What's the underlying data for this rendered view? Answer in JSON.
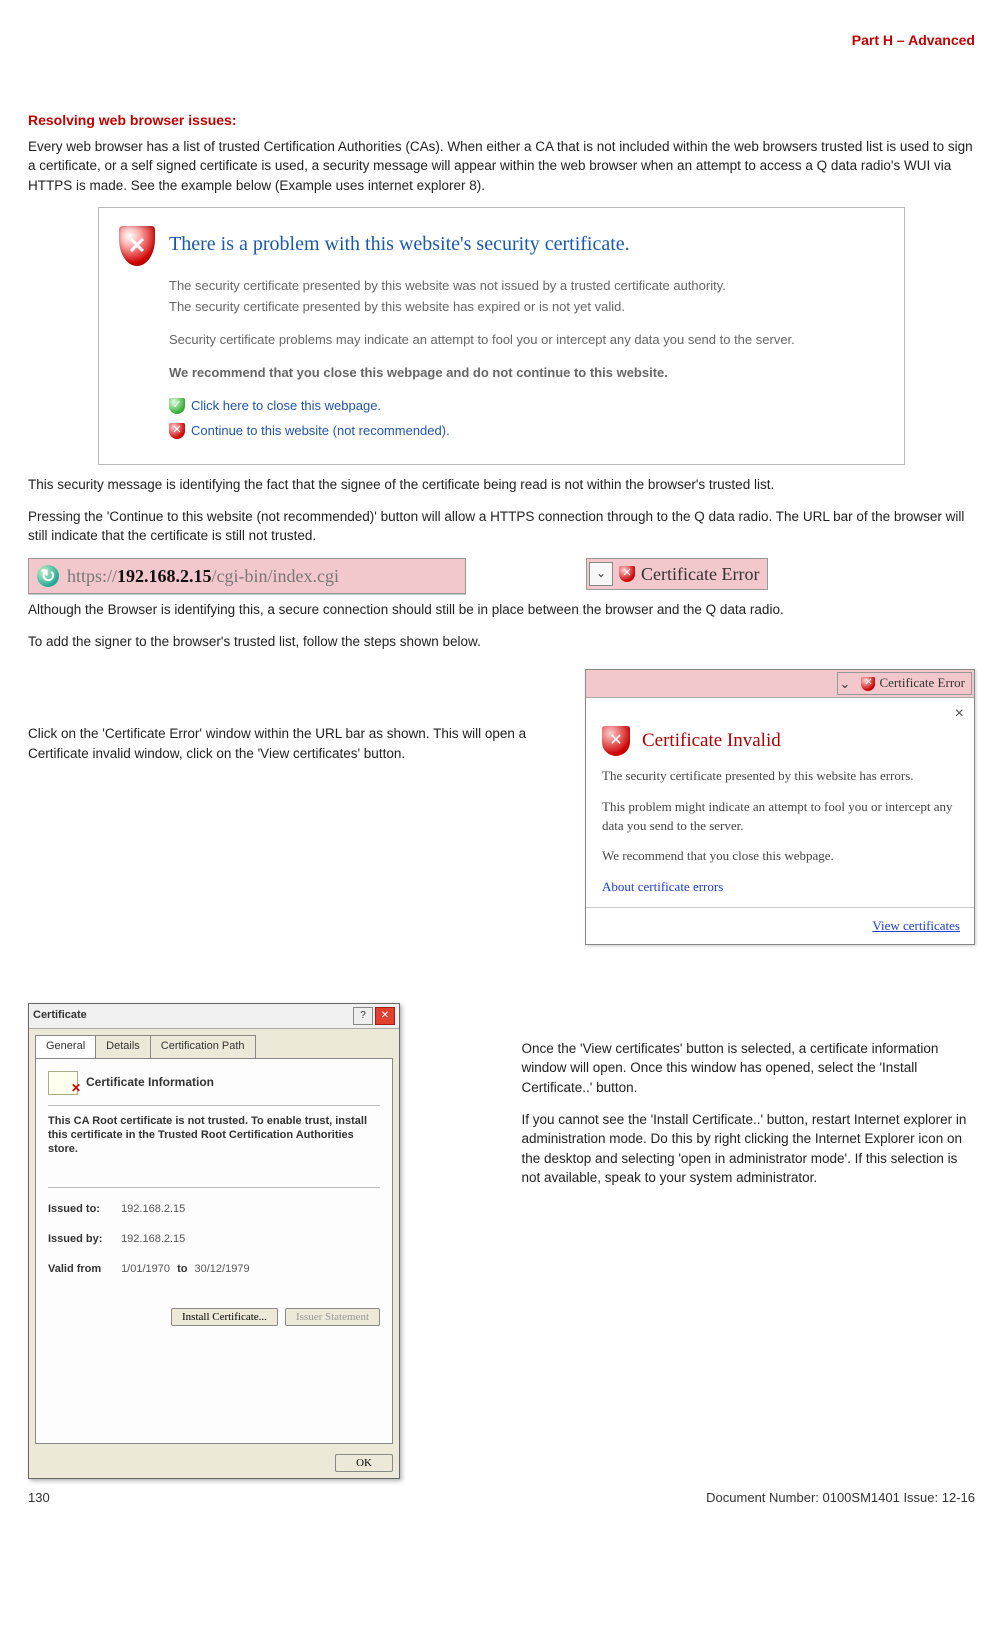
{
  "header": {
    "part": "Part H – Advanced"
  },
  "intro": {
    "heading": "Resolving web browser issues:",
    "p1": "Every web browser has a list of trusted Certification Authorities (CAs). When either a CA that is not included within the web browsers trusted list is used to sign a certificate, or a self signed certificate is used, a security message will appear within the web browser when an attempt to access a Q data radio's WUI via HTTPS is made. See the example below (Example uses internet explorer 8)."
  },
  "ie_warning": {
    "title": "There is a problem with this website's security certificate.",
    "l1": "The security certificate presented by this website was not issued by a trusted certificate authority.",
    "l2": "The security certificate presented by this website has expired or is not yet valid.",
    "l3": "Security certificate problems may indicate an attempt to fool you or intercept any data you send to the server.",
    "l4": "We recommend that you close this webpage and do not continue to this website.",
    "link_close": "Click here to close this webpage.",
    "link_continue": "Continue to this website (not recommended)."
  },
  "mid": {
    "p2": "This security message is identifying the fact that the signee of the certificate being read is not within the browser's trusted list.",
    "p3": "Pressing the 'Continue to this website (not recommended)' button will allow a HTTPS connection through to the Q data radio. The URL bar of the browser will still indicate that the certificate is still not trusted.",
    "url_scheme": "https://",
    "url_ip": "192.168.2.15",
    "url_path": "/cgi-bin/index.cgi",
    "cert_error_label": "Certificate Error",
    "p4": "Although the Browser is identifying this, a secure connection should still be in place between the browser and the Q data radio.",
    "p5": "To add the signer to the browser's trusted list, follow the steps shown below."
  },
  "step1": {
    "left_text": "Click on the 'Certificate Error' window within the URL bar as shown. This will open a Certificate invalid window, click on the 'View certificates' button.",
    "popup": {
      "top_label": "Certificate Error",
      "title": "Certificate Invalid",
      "p1": "The security certificate presented by this website has errors.",
      "p2": "This problem might indicate an attempt to fool you or intercept any data you send to the server.",
      "p3": "We recommend that you close this webpage.",
      "about_link": "About certificate errors",
      "view_link": "View certificates"
    }
  },
  "step2": {
    "dialog": {
      "title": "Certificate",
      "tabs": [
        "General",
        "Details",
        "Certification Path"
      ],
      "info_heading": "Certificate Information",
      "msg": "This CA Root certificate is not trusted. To enable trust, install this certificate in the Trusted Root Certification Authorities store.",
      "issued_to_label": "Issued to:",
      "issued_to": "192.168.2.15",
      "issued_by_label": "Issued by:",
      "issued_by": "192.168.2.15",
      "valid_label": "Valid from",
      "valid_from": "1/01/1970",
      "valid_to_label": "to",
      "valid_to": "30/12/1979",
      "install_btn": "Install Certificate...",
      "issuer_btn": "Issuer Statement",
      "ok_btn": "OK"
    },
    "right_p1": "Once the 'View certificates' button is selected, a certificate information window will open. Once this window has opened, select the 'Install Certificate..' button.",
    "right_p2": "If you cannot see the 'Install Certificate..' button, restart Internet explorer in administration mode. Do this by right clicking the Internet Explorer icon on the desktop and selecting 'open in administrator mode'. If this selection is not available, speak to your system administrator."
  },
  "footer": {
    "page": "130",
    "doc": "Document Number: 0100SM1401   Issue: 12-16"
  }
}
